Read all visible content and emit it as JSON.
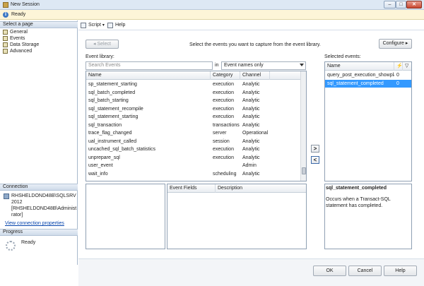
{
  "window": {
    "title": "New Session",
    "controls": {
      "minimize": "–",
      "maximize": "□",
      "close": "✕"
    }
  },
  "status": {
    "text": "Ready"
  },
  "sidebar": {
    "select_page_header": "Select a page",
    "pages": [
      {
        "label": "General"
      },
      {
        "label": "Events"
      },
      {
        "label": "Data Storage"
      },
      {
        "label": "Advanced"
      }
    ],
    "connection_header": "Connection",
    "connection_server": "RHSHELDOND48B\\SQLSRV2012",
    "connection_user": "[RHSHELDOND48B\\Administrator]",
    "connection_link": "View connection properties",
    "progress_header": "Progress",
    "progress_status": "Ready"
  },
  "toolbar": {
    "script_label": "Script",
    "help_label": "Help"
  },
  "events": {
    "select_button": "Select",
    "instruction": "Select the events you want to capture from the event library.",
    "configure_button": "Configure",
    "library_label": "Event library:",
    "search_placeholder": "Search Events",
    "in_label": "in",
    "filter_selected": "Event names only",
    "library_columns": {
      "name": "Name",
      "category": "Category",
      "channel": "Channel"
    },
    "library_rows": [
      {
        "name": "sp_statement_starting",
        "category": "execution",
        "channel": "Analytic"
      },
      {
        "name": "sql_batch_completed",
        "category": "execution",
        "channel": "Analytic"
      },
      {
        "name": "sql_batch_starting",
        "category": "execution",
        "channel": "Analytic"
      },
      {
        "name": "sql_statement_recompile",
        "category": "execution",
        "channel": "Analytic"
      },
      {
        "name": "sql_statement_starting",
        "category": "execution",
        "channel": "Analytic"
      },
      {
        "name": "sql_transaction",
        "category": "transactions",
        "channel": "Analytic"
      },
      {
        "name": "trace_flag_changed",
        "category": "server",
        "channel": "Operational"
      },
      {
        "name": "ual_instrument_called",
        "category": "session",
        "channel": "Analytic"
      },
      {
        "name": "uncached_sql_batch_statistics",
        "category": "execution",
        "channel": "Analytic"
      },
      {
        "name": "unprepare_sql",
        "category": "execution",
        "channel": "Analytic"
      },
      {
        "name": "user_event",
        "category": "",
        "channel": "Admin"
      },
      {
        "name": "wait_info",
        "category": "scheduling",
        "channel": "Analytic"
      }
    ],
    "selected_label": "Selected events:",
    "selected_columns": {
      "name": "Name"
    },
    "selected_rows": [
      {
        "name": "query_post_execution_showplan",
        "count": "0"
      },
      {
        "name": "sql_statement_completed",
        "count": "0"
      }
    ],
    "field_columns": {
      "event_fields": "Event Fields",
      "description": "Description"
    },
    "detail_title": "sql_statement_completed",
    "detail_description": "Occurs when a Transact-SQL statement has completed.",
    "move_right": ">",
    "move_left": "<"
  },
  "footer": {
    "ok": "OK",
    "cancel": "Cancel",
    "help": "Help"
  },
  "colors": {
    "selection": "#3399ff",
    "link": "#0645ad",
    "status_bg": "#fdf5d8"
  }
}
